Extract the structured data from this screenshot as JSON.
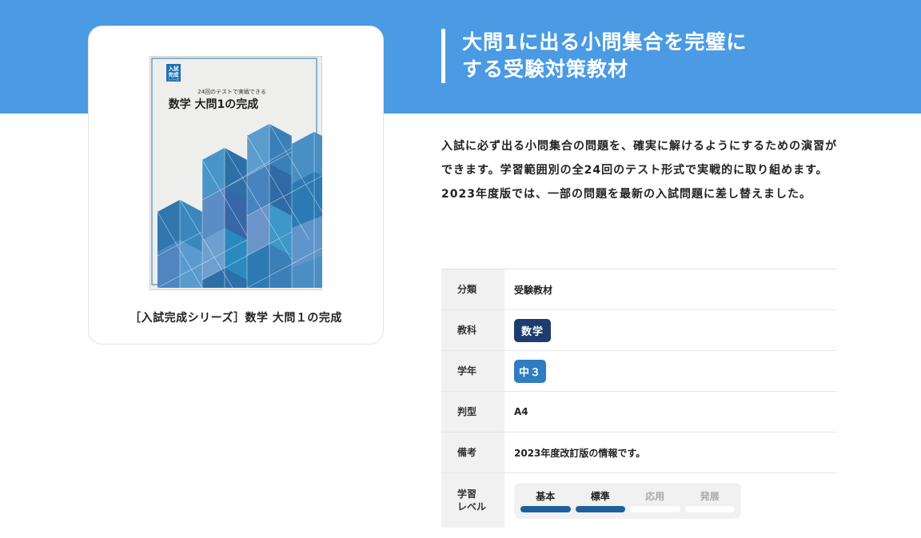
{
  "header": {
    "title_line1": "大問1に出る小問集合を完璧に",
    "title_line2": "する受験対策教材"
  },
  "product": {
    "name": "［入試完成シリーズ］数学 大問１の完成",
    "cover": {
      "series_badge": "入試\n完成",
      "series_small": "シリーズ",
      "subtitle": "24回のテストで実戦できる",
      "title": "数学  大問1の完成"
    }
  },
  "description": "入試に必ず出る小問集合の問題を、確実に解けるようにするための演習ができます。学習範囲別の全24回のテスト形式で実戦的に取り組めます。2023年度版では、一部の問題を最新の入試問題に差し替えました。",
  "spec": {
    "category_label": "分類",
    "category_value": "受験教材",
    "subject_label": "教科",
    "subject_value": "数学",
    "grade_label": "学年",
    "grade_value": "中３",
    "size_label": "判型",
    "size_value": "A4",
    "note_label": "備考",
    "note_value": "2023年度改訂版の情報です。",
    "level_label": "学習\nレベル",
    "levels": [
      {
        "label": "基本",
        "active": true
      },
      {
        "label": "標準",
        "active": true
      },
      {
        "label": "応用",
        "active": false
      },
      {
        "label": "発展",
        "active": false
      }
    ]
  },
  "colors": {
    "hero": "#4a9be3",
    "subject_badge": "#1c3d6d",
    "grade_badge": "#2e7cc2",
    "level_active": "#1f5f9c"
  }
}
